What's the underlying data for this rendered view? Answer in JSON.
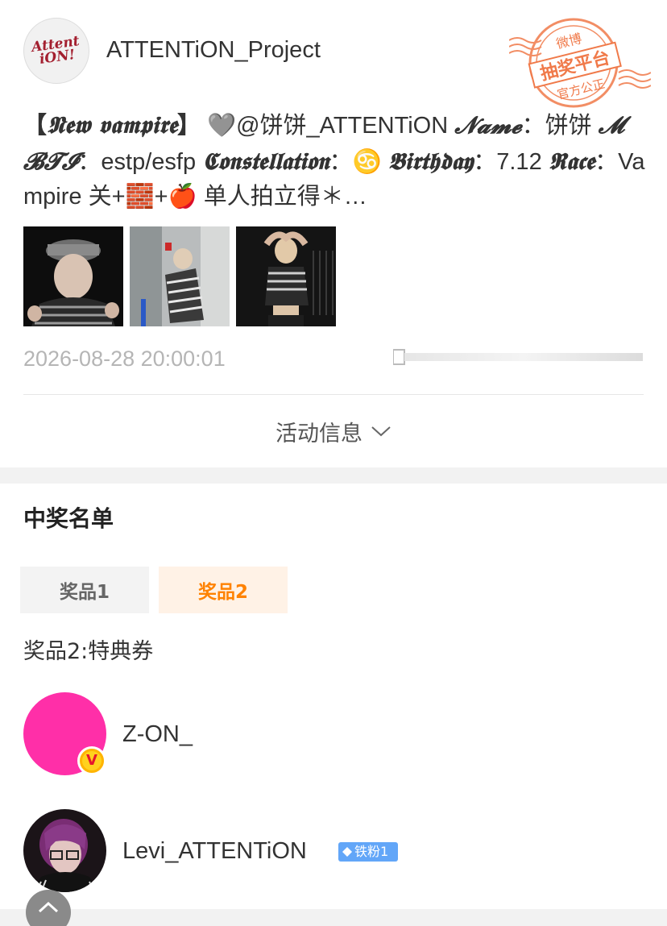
{
  "post": {
    "author": "ATTENTiON_Project",
    "avatar_logo": "Attent iON!",
    "stamp": {
      "top": "微博",
      "main": "抽奖平台",
      "bottom": "官方公正"
    },
    "text_segments": {
      "s1": "【",
      "s2": "𝕹𝖊𝖜 𝖛𝖆𝖒𝖕𝖎𝖗𝖊",
      "s3": "】",
      "s4": " 🩶@饼饼_ATTENTiON ",
      "s5": "𝓝𝓪𝓶𝓮",
      "s6": "：饼饼 ",
      "s7": "𝓜𝓑𝓣𝓘",
      "s8": "：estp/esfp ",
      "s9": "𝕮𝖔𝖓𝖘𝖙𝖊𝖑𝖑𝖆𝖙𝖎𝖔𝖓",
      "s10": "：♋ ",
      "s11": "𝕭𝖎𝖗𝖙𝖍𝖉𝖆𝖞",
      "s12": "：7.12 ",
      "s13": "𝕽𝖆𝖈𝖊",
      "s14": "：Vampire 关+🧱+🍎 单人拍立得＊…"
    },
    "time": "2026-08-28 20:00:01",
    "activity_toggle": "活动信息"
  },
  "winners": {
    "title": "中奖名单",
    "tabs": [
      {
        "label": "奖品1",
        "active": false
      },
      {
        "label": "奖品2",
        "active": true
      }
    ],
    "prize_caption": "奖品2:特典券",
    "list": [
      {
        "name": "Z-ON_",
        "avatar_color": "#ff2fa8",
        "verified": true,
        "badge_letter": "V"
      },
      {
        "name": "Levi_ATTENTiON",
        "badge": "铁粉1"
      }
    ]
  },
  "colors": {
    "accent": "#ff8200",
    "stamp": "#f07a4a",
    "fan_badge": "#62a6f8"
  },
  "icons": [
    "chevron-down-icon",
    "verified-v-icon",
    "diamond-icon",
    "chevron-up-icon"
  ]
}
